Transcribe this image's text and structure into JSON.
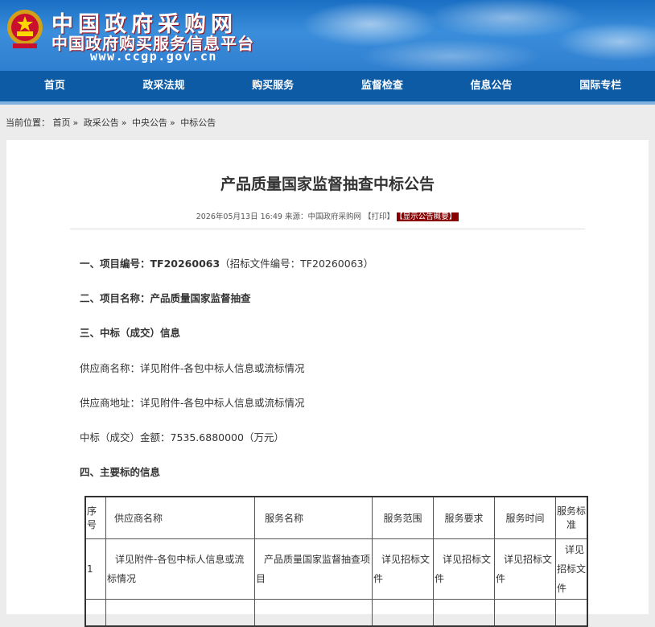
{
  "header": {
    "site_title": "中国政府采购网",
    "site_subtitle": "中国政府购买服务信息平台",
    "site_url": "www.ccgp.gov.cn"
  },
  "nav": [
    "首页",
    "政采法规",
    "购买服务",
    "监督检查",
    "信息公告",
    "国际专栏"
  ],
  "breadcrumb": {
    "prefix": "当前位置：",
    "items": [
      "首页",
      "政采公告",
      "中央公告",
      "中标公告"
    ]
  },
  "article": {
    "title": "产品质量国家监督抽查中标公告",
    "meta": "2026年05月13日 16:49 来源：中国政府采购网 【打印】",
    "show_summary": "【显示公告概要】",
    "s1_label": "一、项目编号：",
    "s1_value": "TF20260063",
    "s1_note": "（招标文件编号：TF20260063）",
    "s2_label": "二、项目名称：",
    "s2_value": "产品质量国家监督抽查",
    "s3_label": "三、中标（成交）信息",
    "supplier_name": "供应商名称：详见附件-各包中标人信息或流标情况",
    "supplier_addr": "供应商地址：详见附件-各包中标人信息或流标情况",
    "amount": "中标（成交）金额：7535.6880000（万元）",
    "s4_label": "四、主要标的信息"
  },
  "table": {
    "headers": [
      "序号",
      "供应商名称",
      "服务名称",
      "服务范围",
      "服务要求",
      "服务时间",
      "服务标准"
    ],
    "rows": [
      [
        "1",
        "详见附件-各包中标人信息或流标情况",
        "产品质量国家监督抽查项目",
        "详见招标文件",
        "详见招标文件",
        "详见招标文件",
        "详见招标文件"
      ]
    ]
  },
  "colors": {
    "nav_bg": "#0d5aa5",
    "accent_red": "#8b0000"
  }
}
